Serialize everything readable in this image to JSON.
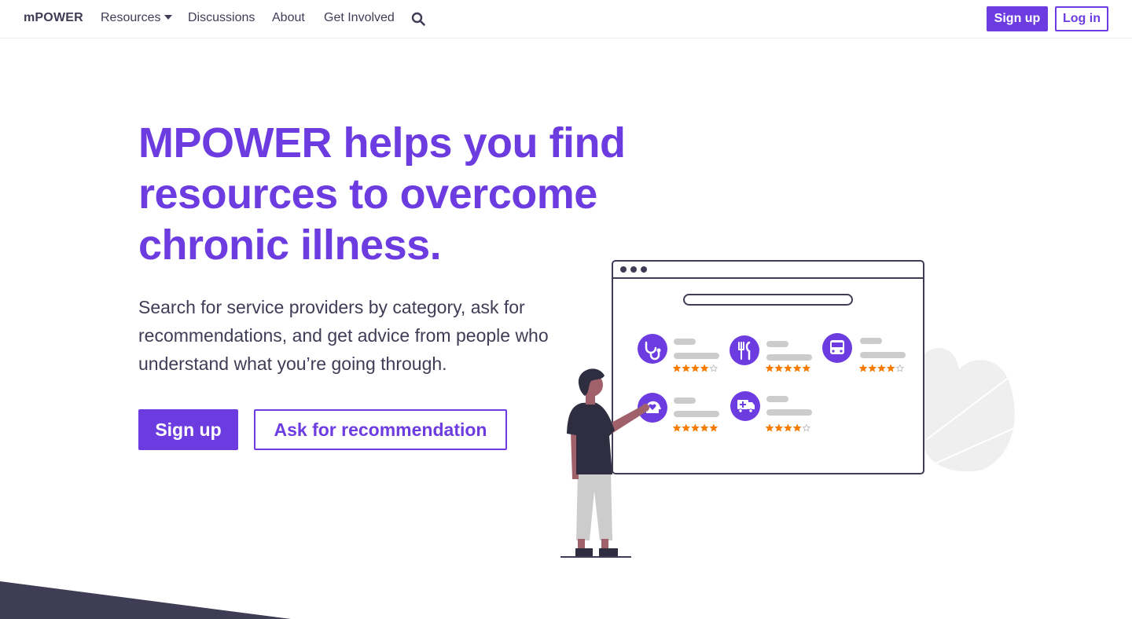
{
  "nav": {
    "brand": "mPOWER",
    "resources": "Resources",
    "discussions": "Discussions",
    "about": "About",
    "get_involved": "Get Involved",
    "search_icon": "search-icon",
    "signup": "Sign up",
    "login": "Log in"
  },
  "hero": {
    "title": "MPOWER helps you find resources to overcome chronic illness.",
    "subtitle": "Search for service providers by category, ask for recommendations, and get advice from people who understand what you’re going through.",
    "signup": "Sign up",
    "ask": "Ask for recommendation"
  },
  "illustration": {
    "categories": [
      {
        "icon": "stethoscope-icon",
        "stars": 4
      },
      {
        "icon": "utensils-icon",
        "stars": 5
      },
      {
        "icon": "bus-icon",
        "stars": 4
      },
      {
        "icon": "heart-head-icon",
        "stars": 5
      },
      {
        "icon": "ambulance-icon",
        "stars": 4
      }
    ]
  },
  "colors": {
    "accent": "#6c3ce1",
    "text": "#3f3d56",
    "star": "#f57c00",
    "placeholder": "#cccccc"
  }
}
